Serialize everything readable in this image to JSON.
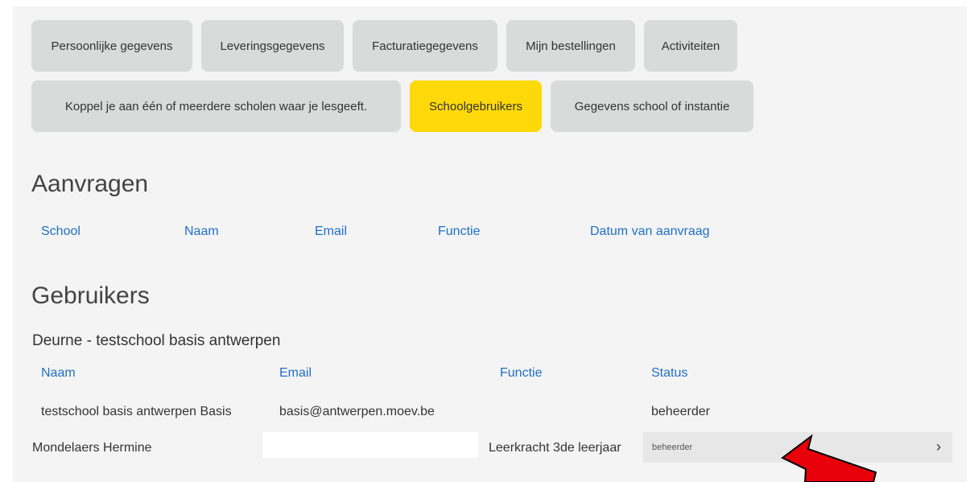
{
  "tabs_row1": [
    {
      "label": "Persoonlijke gegevens",
      "active": false
    },
    {
      "label": "Leveringsgegevens",
      "active": false
    },
    {
      "label": "Facturatiegegevens",
      "active": false
    },
    {
      "label": "Mijn bestellingen",
      "active": false
    },
    {
      "label": "Activiteiten",
      "active": false
    }
  ],
  "tabs_row2": [
    {
      "label": "Koppel je aan één of meerdere scholen waar je lesgeeft.",
      "active": false
    },
    {
      "label": "Schoolgebruikers",
      "active": true
    },
    {
      "label": "Gegevens school of instantie",
      "active": false
    }
  ],
  "requests": {
    "title": "Aanvragen",
    "columns": [
      "School",
      "Naam",
      "Email",
      "Functie",
      "Datum van aanvraag"
    ]
  },
  "users": {
    "title": "Gebruikers",
    "school_name": "Deurne - testschool basis antwerpen",
    "columns": [
      "Naam",
      "Email",
      "Functie",
      "Status"
    ],
    "rows": [
      {
        "name": "testschool basis antwerpen Basis",
        "email": "basis@antwerpen.moev.be",
        "function": "",
        "status": "beheerder"
      },
      {
        "name": "Mondelaers Hermine",
        "email": "",
        "function": "Leerkracht 3de leerjaar",
        "status": "beheerder"
      }
    ]
  },
  "colors": {
    "accent": "#fed90a",
    "tab_bg": "#d8dbda",
    "link": "#1f6fc6",
    "arrow": "#e8000a"
  },
  "icons": {
    "select_chevron": "chevron-right-icon",
    "annotation": "red-arrow-icon"
  }
}
